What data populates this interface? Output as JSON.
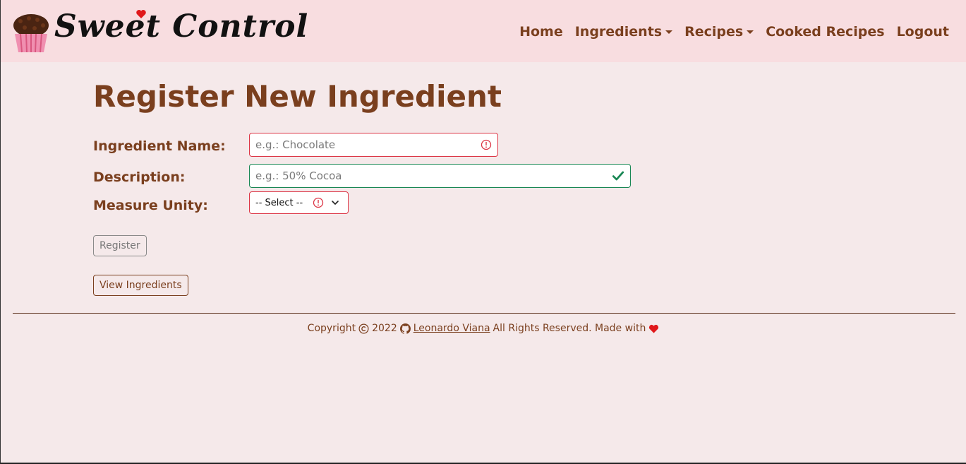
{
  "brand": {
    "name": "Sweet Control"
  },
  "nav": {
    "items": [
      {
        "label": "Home",
        "dropdown": false
      },
      {
        "label": "Ingredients",
        "dropdown": true
      },
      {
        "label": "Recipes",
        "dropdown": true
      },
      {
        "label": "Cooked Recipes",
        "dropdown": false
      },
      {
        "label": "Logout",
        "dropdown": false
      }
    ]
  },
  "page": {
    "title": "Register New Ingredient"
  },
  "form": {
    "name_label": "Ingredient Name:",
    "name_placeholder": "e.g.: Chocolate",
    "name_state": "invalid",
    "description_label": "Description:",
    "description_placeholder": "e.g.: 50% Cocoa",
    "description_state": "valid",
    "measure_label": "Measure Unity:",
    "measure_selected": "-- Select --",
    "measure_state": "invalid",
    "register_label": "Register",
    "view_label": "View Ingredients"
  },
  "footer": {
    "copyright_prefix": "Copyright",
    "year": "2022",
    "author": "Leonardo Viana",
    "suffix": "All Rights Reserved. Made with"
  },
  "colors": {
    "brand_brown": "#7a3f1e",
    "navbar_bg": "#f8dde0",
    "page_bg": "#f5e9ea",
    "invalid": "#dc3545",
    "valid": "#198754",
    "heart": "#e0181b"
  }
}
